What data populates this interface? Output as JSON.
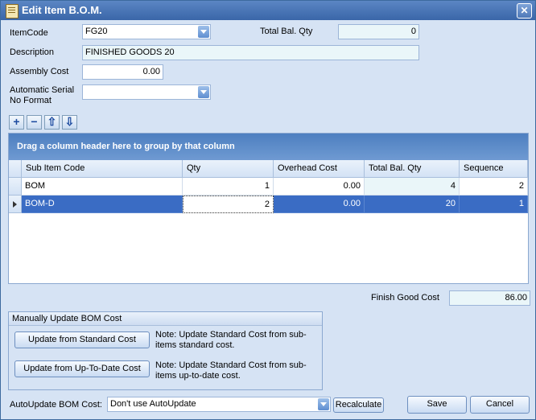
{
  "window": {
    "title": "Edit Item B.O.M.",
    "close_label": "✕"
  },
  "form": {
    "item_code_label": "ItemCode",
    "item_code_value": "FG20",
    "total_bal_qty_label": "Total Bal. Qty",
    "total_bal_qty_value": "0",
    "description_label": "Description",
    "description_value": "FINISHED GOODS 20",
    "assembly_cost_label": "Assembly Cost",
    "assembly_cost_value": "0.00",
    "auto_serial_label_line1": "Automatic Serial",
    "auto_serial_label_line2": "No Format",
    "auto_serial_value": ""
  },
  "toolbar": {
    "add": "+",
    "remove": "−",
    "up": "⇧",
    "down": "⇩"
  },
  "grid": {
    "group_prompt": "Drag a column header here to group by that column",
    "columns": [
      "Sub Item Code",
      "Qty",
      "Overhead Cost",
      "Total Bal. Qty",
      "Sequence"
    ],
    "rows": [
      {
        "sub_item_code": "BOM",
        "qty": "1",
        "overhead_cost": "0.00",
        "total_bal_qty": "4",
        "sequence": "2"
      },
      {
        "sub_item_code": "BOM-D",
        "qty": "2",
        "overhead_cost": "0.00",
        "total_bal_qty": "20",
        "sequence": "1"
      }
    ]
  },
  "finish_good": {
    "label": "Finish Good Cost",
    "value": "86.00"
  },
  "manual_update": {
    "title": "Manually Update BOM Cost",
    "standard_button": "Update from Standard Cost",
    "standard_note": "Note: Update Standard Cost from sub-items standard cost.",
    "uptodate_button": "Update from Up-To-Date Cost",
    "uptodate_note": "Note: Update Standard Cost from sub-items up-to-date cost."
  },
  "footer": {
    "autoupdate_label": "AutoUpdate BOM Cost:",
    "autoupdate_value": "Don't use AutoUpdate",
    "recalculate": "Recalculate",
    "save": "Save",
    "cancel": "Cancel"
  }
}
